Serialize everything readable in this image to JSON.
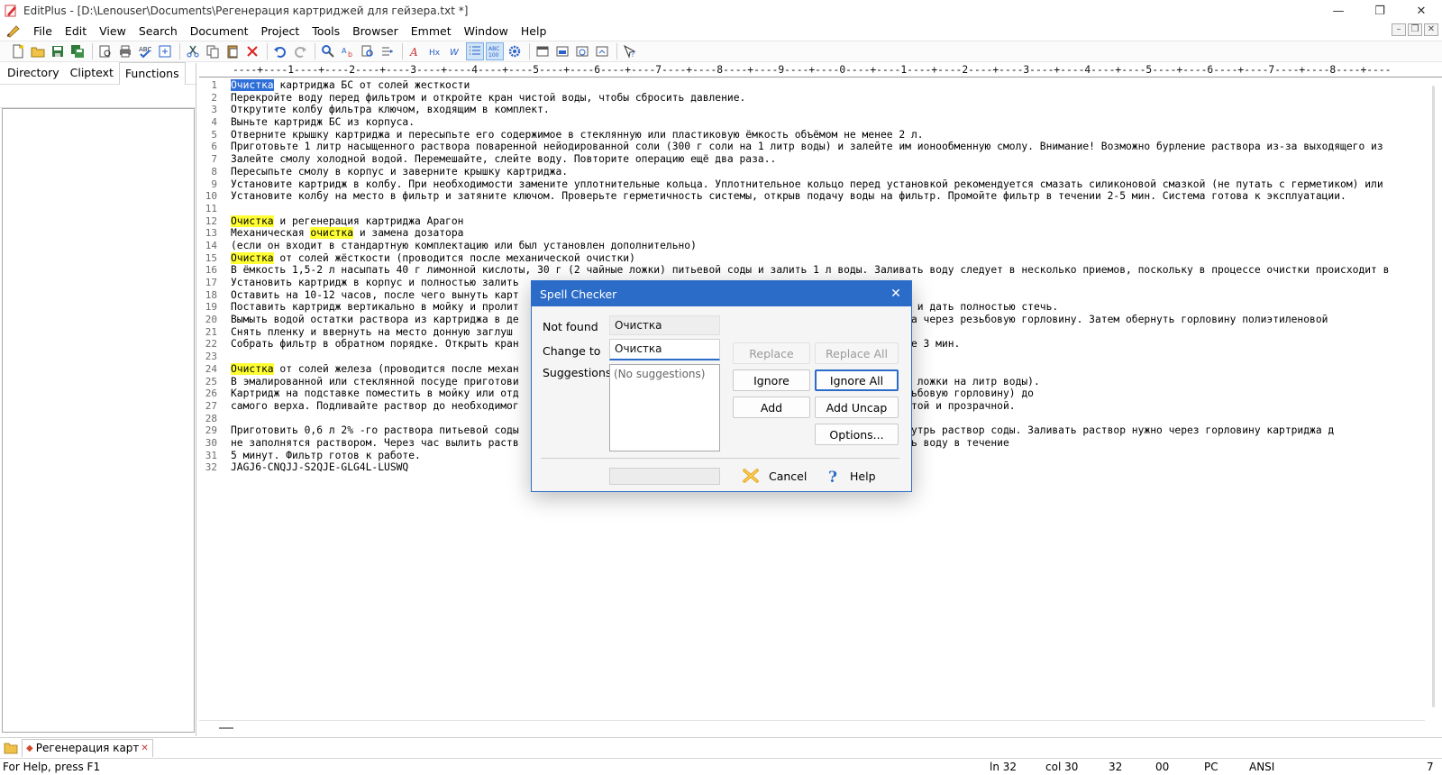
{
  "window": {
    "title": "EditPlus - [D:\\Lenouser\\Documents\\Регенерация картриджей для гейзера.txt *]",
    "minimize": "—",
    "restore": "❐",
    "close": "✕"
  },
  "menu": [
    "File",
    "Edit",
    "View",
    "Search",
    "Document",
    "Project",
    "Tools",
    "Browser",
    "Emmet",
    "Window",
    "Help"
  ],
  "mdi": {
    "minimize": "–",
    "restore": "❐",
    "close": "✕"
  },
  "left_tabs": [
    "Directory",
    "Cliptext",
    "Functions"
  ],
  "ruler": "----+----1----+----2----+----3----+----4----+----5----+----6----+----7----+----8----+----9----+----0----+----1----+----2----+----3----+----4----+----5----+----6----+----7----+----8----+----",
  "lines": [
    [
      {
        "t": "Очистка",
        "s": "sel"
      },
      {
        "t": " картриджа БС от солей жесткости"
      }
    ],
    [
      {
        "t": "Перекройте воду перед фильтром и откройте кран чистой воды, чтобы сбросить давление."
      }
    ],
    [
      {
        "t": "Открутите колбу фильтра ключом, входящим в комплект."
      }
    ],
    [
      {
        "t": "Выньте картридж БС из корпуса."
      }
    ],
    [
      {
        "t": "Отверните крышку картриджа и пересыпьте его содержимое в стеклянную или пластиковую ёмкость объёмом не менее 2 л."
      }
    ],
    [
      {
        "t": "Приготовьте 1 литр насыщенного раствора поваренной нейодированной соли (300 г соли на 1 литр воды) и залейте им ионообменную смолу. Внимание! Возможно бурление раствора из-за выходящего из"
      }
    ],
    [
      {
        "t": "Залейте смолу холодной водой. Перемешайте, слейте воду. Повторите операцию ещё два раза.."
      }
    ],
    [
      {
        "t": "Пересыпьте смолу в корпус и заверните крышку картриджа."
      }
    ],
    [
      {
        "t": "Установите картридж в колбу. При необходимости замените уплотнительные кольца. Уплотнительное кольцо перед установкой рекомендуется смазать силиконовой смазкой (не путать с герметиком) или"
      }
    ],
    [
      {
        "t": "Установите колбу на место в фильтр и затяните ключом. Проверьте герметичность системы, открыв подачу воды на фильтр. Промойте фильтр в течении 2-5 мин. Система готова к эксплуатации."
      }
    ],
    [
      {
        "t": ""
      }
    ],
    [
      {
        "t": "Очистка",
        "s": "hl"
      },
      {
        "t": " и регенерация картриджа Арагон"
      }
    ],
    [
      {
        "t": "Механическая "
      },
      {
        "t": "очистка",
        "s": "hl"
      },
      {
        "t": " и замена дозатора"
      }
    ],
    [
      {
        "t": "(если он входит в стандартную комплектацию или был установлен дополнительно)"
      }
    ],
    [
      {
        "t": "Очистка",
        "s": "hl"
      },
      {
        "t": " от солей жёсткости (проводится после механической очистки)"
      }
    ],
    [
      {
        "t": "В ёмкость 1,5-2 л насыпать 40 г лимонной кислоты, 30 г (2 чайные ложки) питьевой соды и залить 1 л воды. Заливать воду следует в несколько приемов, поскольку в процессе очистки происходит в"
      }
    ],
    [
      {
        "t": "Установить картридж в корпус и полностью залить"
      }
    ],
    [
      {
        "t": "Оставить на 10-12 часов, после чего вынуть карт"
      }
    ],
    [
      {
        "t": "Поставить картридж вертикально в мойку и пролит                                                   ую горловину, и дать полностью стечь."
      }
    ],
    [
      {
        "t": "Вымыть водой остатки раствора из картриджа в де                                                   ерха картриджа через резьбовую горловину. Затем обернуть горловину полиэтиленовой"
      }
    ],
    [
      {
        "t": "Снять пленку и ввернуть на место донную заглуш"
      }
    ],
    [
      {
        "t": "Собрать фильтр в обратном порядке. Открыть кран                                                   /мин в течение 3 мин."
      }
    ],
    [
      {
        "t": ""
      }
    ],
    [
      {
        "t": "Очистка",
        "s": "hl"
      },
      {
        "t": " от солей железа (проводится после механ"
      }
    ],
    [
      {
        "t": "В эмалированной или стеклянной посуде приготови                                                   ли 2 столовые ложки на литр воды)."
      }
    ],
    [
      {
        "t": "Картридж на подставке поместить в мойку или отд                                                   жа (через резьбовую горловину) до"
      }
    ],
    [
      {
        "t": "самого верха. Подливайте раствор до необходимог                                                   не станет чистой и прозрачной."
      }
    ],
    [
      {
        "t": ""
      }
    ],
    [
      {
        "t": "Приготовить 0,6 л 2% -го раствора питьевой соды                                                   с и залить внутрь раствор соды. Заливать раствор нужно через горловину картриджа д"
      }
    ],
    [
      {
        "t": "не заполнятся раствором. Через час вылить раств                                                   воды и пролить воду в течение"
      }
    ],
    [
      {
        "t": "5 минут. Фильтр готов к работе."
      }
    ],
    [
      {
        "t": "JAGJ6-CNQJJ-S2QJE-GLG4L-LUSWQ"
      }
    ]
  ],
  "file_tab": {
    "label": "Регенерация карт",
    "close": "✕"
  },
  "status": {
    "help": "For Help, press F1",
    "ln": "ln 32",
    "col": "col 30",
    "total": "32",
    "code": "00",
    "mode": "PC",
    "encoding": "ANSI",
    "extra": "7"
  },
  "dialog": {
    "title": "Spell Checker",
    "not_found_label": "Not found",
    "not_found_value": "Очистка",
    "change_to_label": "Change to",
    "change_to_value": "Очистка",
    "suggestions_label": "Suggestions",
    "suggestions_empty": "(No suggestions)",
    "replace": "Replace",
    "replace_all": "Replace All",
    "ignore": "Ignore",
    "ignore_all": "Ignore All",
    "add": "Add",
    "add_uncap": "Add Uncap",
    "options": "Options...",
    "cancel": "Cancel",
    "help": "Help"
  },
  "colors": {
    "accent": "#2b6cc9",
    "highlight": "#ffff33",
    "selection": "#2f6fd8"
  }
}
